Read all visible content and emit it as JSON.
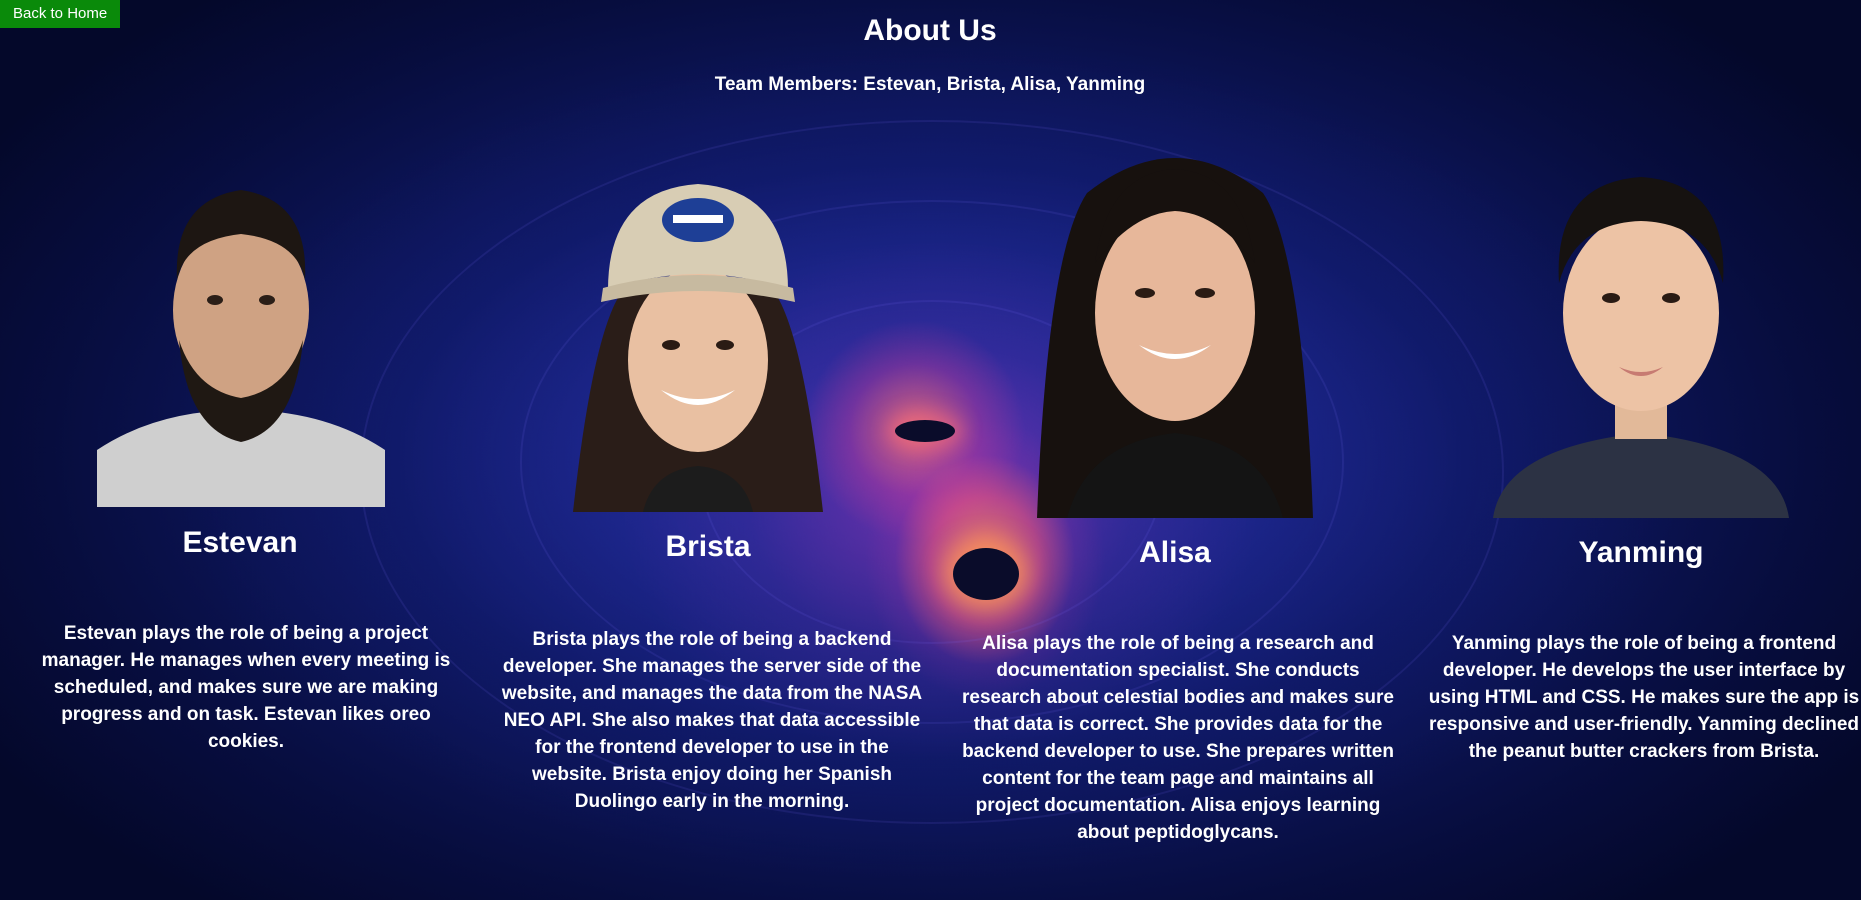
{
  "nav": {
    "back_label": "Back to Home"
  },
  "header": {
    "title": "About Us",
    "subtitle": "Team Members: Estevan, Brista, Alisa, Yanming"
  },
  "members": [
    {
      "name": "Estevan",
      "bio": "Estevan plays the role of being a project manager. He manages when every meeting is scheduled, and makes sure we are making progress and on task. Estevan likes oreo cookies."
    },
    {
      "name": "Brista",
      "bio": "Brista plays the role of being a backend developer. She manages the server side of the website, and manages the data from the NASA NEO API. She also makes that data accessible for the frontend developer to use in the website. Brista enjoy doing her Spanish Duolingo early in the morning."
    },
    {
      "name": "Alisa",
      "bio": "Alisa plays the role of being a research and documentation specialist. She conducts research about celestial bodies and makes sure that data is correct. She provides data for the backend developer to use. She prepares written content for the team page and maintains all project documentation. Alisa enjoys learning about peptidoglycans."
    },
    {
      "name": "Yanming",
      "bio": "Yanming plays the role of being a frontend developer. He develops the user interface by using HTML and CSS. He makes sure the app is responsive and user-friendly. Yanming declined the peanut butter crackers from Brista."
    }
  ],
  "colors": {
    "back_button": "#0a8a0a",
    "text": "#ffffff",
    "background_deep": "#070d3e",
    "background_mid": "#1a2a9a",
    "accretion_glow": "#ff8c5a"
  }
}
